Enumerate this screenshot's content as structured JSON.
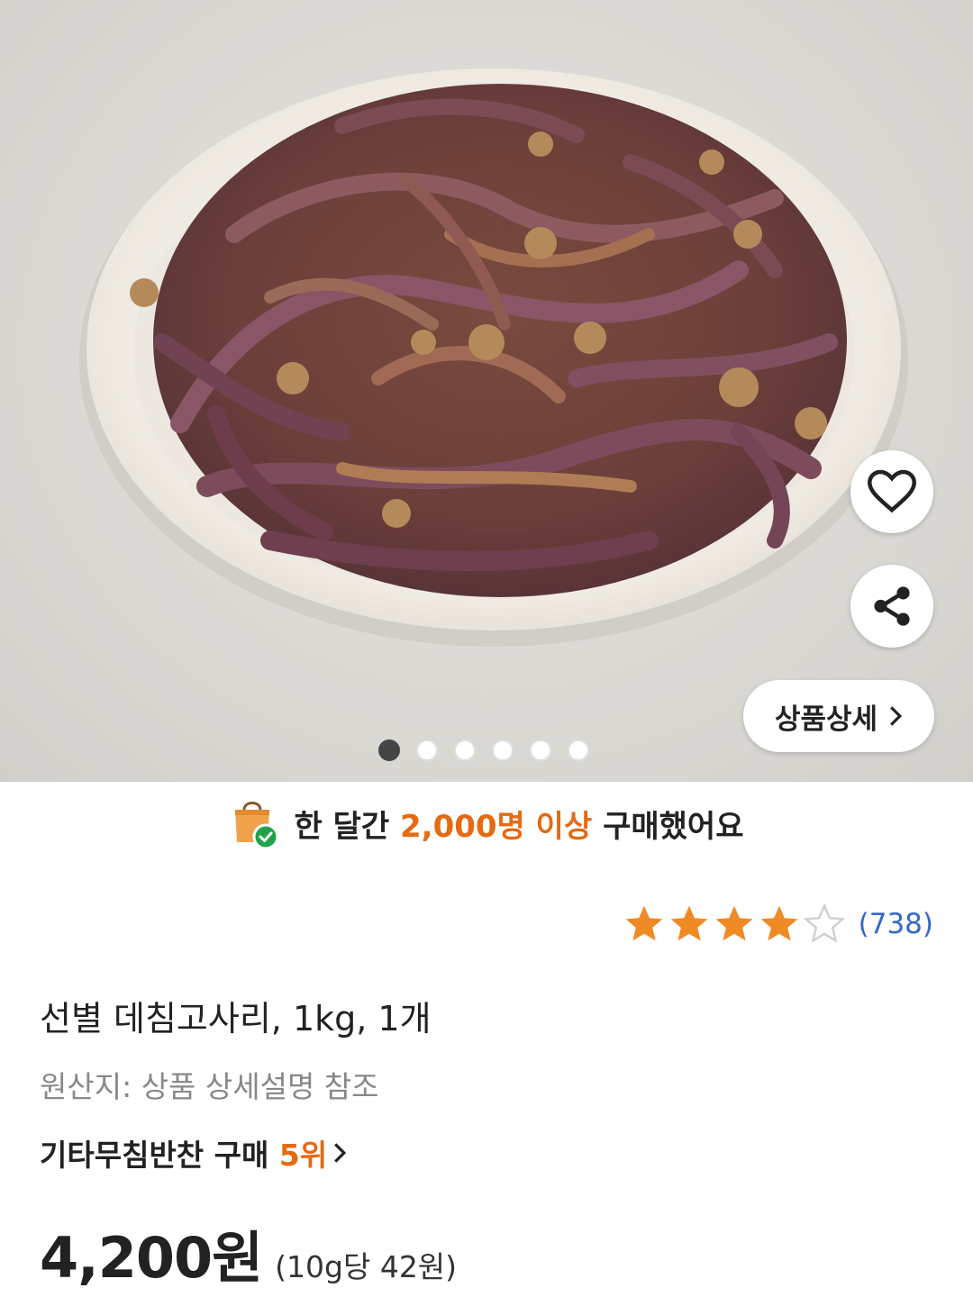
{
  "hero": {
    "dots_total": 6,
    "active_dot": 1,
    "detail_button_label": "상품상세",
    "like_icon": "heart-icon",
    "share_icon": "share-icon"
  },
  "banner": {
    "prefix": "한 달간 ",
    "highlight": "2,000명 이상",
    "suffix": " 구매했어요",
    "icon": "shopping-bag-check-icon"
  },
  "rating": {
    "stars": 4,
    "max_stars": 5,
    "count": "(738)"
  },
  "product": {
    "title": "선별 데침고사리, 1kg, 1개",
    "origin": "원산지: 상품 상세설명 참조",
    "rank_prefix": "기타무침반찬 구매 ",
    "rank_value": "5위",
    "price": "4,200원",
    "unit_price": "(10g당 42원)"
  },
  "colors": {
    "accent": "#e56a12",
    "link": "#3468c8",
    "star": "#f08a24"
  }
}
